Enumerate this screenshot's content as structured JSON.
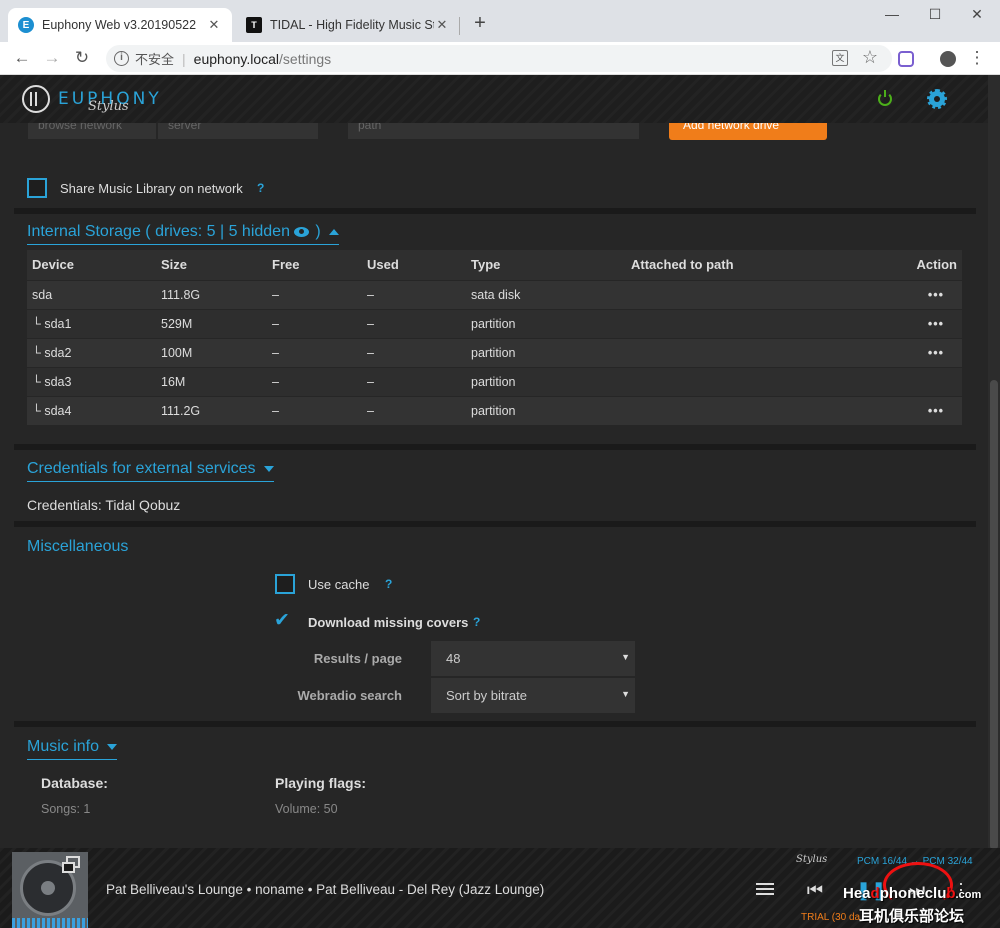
{
  "browser": {
    "tabs": [
      {
        "title": "Euphony Web v3.20190522",
        "favicon": "E"
      },
      {
        "title": "TIDAL - High Fidelity Music St",
        "favicon": "T"
      }
    ],
    "new_tab": "+",
    "window_controls": {
      "minimize": "—",
      "maximize": "☐",
      "close": "✕"
    },
    "nav": {
      "back": "←",
      "forward": "→",
      "reload": "↻"
    },
    "address": {
      "insecure_label": "不安全",
      "host": "euphony.local",
      "path": "/settings"
    },
    "star": "☆",
    "menu": "⋮"
  },
  "header": {
    "logo_text": "EUPHONY",
    "logo_script": "Stylus",
    "accent": "#2aa3d8",
    "power_color": "#4caf1a"
  },
  "network": {
    "search_placeholder": "browse network",
    "server_placeholder": "server",
    "path_placeholder": "path",
    "add_button": "Add network drive",
    "share_label": "Share Music Library on network",
    "help": "?"
  },
  "storage": {
    "title_prefix": "Internal Storage ( drives: 5 | 5 hidden",
    "title_suffix": " )",
    "columns": [
      "Device",
      "Size",
      "Free",
      "Used",
      "Type",
      "Attached to path",
      "Action"
    ],
    "rows": [
      {
        "device": "sda",
        "size": "111.8G",
        "free": "–",
        "used": "–",
        "type": "sata disk",
        "path": "",
        "action": "•••"
      },
      {
        "device": "└ sda1",
        "size": "529M",
        "free": "–",
        "used": "–",
        "type": "partition",
        "path": "",
        "action": "•••"
      },
      {
        "device": "└ sda2",
        "size": "100M",
        "free": "–",
        "used": "–",
        "type": "partition",
        "path": "",
        "action": "•••"
      },
      {
        "device": "└ sda3",
        "size": "16M",
        "free": "–",
        "used": "–",
        "type": "partition",
        "path": "",
        "action": ""
      },
      {
        "device": "└ sda4",
        "size": "111.2G",
        "free": "–",
        "used": "–",
        "type": "partition",
        "path": "",
        "action": "•••"
      }
    ]
  },
  "credentials": {
    "title": "Credentials for external services",
    "text": "Credentials: Tidal Qobuz"
  },
  "misc": {
    "title": "Miscellaneous",
    "use_cache": "Use cache",
    "download_covers": "Download missing covers",
    "check_mark": "✔",
    "help": "?",
    "results_label": "Results / page",
    "results_value": "48",
    "webradio_label": "Webradio search",
    "webradio_value": "Sort by bitrate",
    "select_arrow": "▼"
  },
  "music_info": {
    "title": "Music info",
    "database_label": "Database:",
    "songs": "Songs: 1",
    "flags_label": "Playing flags:",
    "volume": "Volume: 50"
  },
  "player": {
    "now_playing": "Pat Belliveau's Lounge • noname • Pat Belliveau - Del Rey (Jazz Lounge)",
    "stylus": "Stylus",
    "pcm": "PCM 16/44 → PCM 32/44",
    "trial": "TRIAL (30 da",
    "prev": "⏮",
    "pause": "❚❚",
    "next": "⏭",
    "more": "⋮"
  },
  "watermark": {
    "line1_a": "Hea",
    "line1_b": "phoneclu",
    "line1_c": ".com",
    "line2": "耳机俱乐部论坛"
  }
}
